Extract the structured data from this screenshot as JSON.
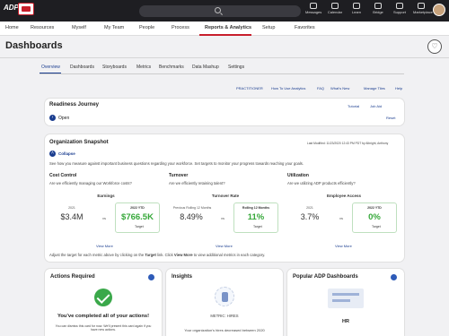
{
  "topbar": {
    "logo": "ADP",
    "icons": [
      {
        "label": "Messages",
        "icon": "envelope-icon"
      },
      {
        "label": "Calendar",
        "icon": "calendar-icon"
      },
      {
        "label": "Learn",
        "icon": "book-icon"
      },
      {
        "label": "Bridge",
        "icon": "bridge-icon"
      },
      {
        "label": "Support",
        "icon": "question-icon"
      },
      {
        "label": "Marketplace",
        "icon": "store-icon"
      }
    ]
  },
  "nav": {
    "items": [
      "Home",
      "Resources",
      "Myself",
      "My Team",
      "People",
      "Process",
      "Reports & Analytics",
      "Setup",
      "Favorites"
    ],
    "active": "Reports & Analytics"
  },
  "page": {
    "title": "Dashboards"
  },
  "tabs": {
    "items": [
      "Overview",
      "Dashboards",
      "Storyboards",
      "Metrics",
      "Benchmarks",
      "Data Mashup",
      "Settings"
    ],
    "active": "Overview"
  },
  "links": {
    "practitioner": "PRACTITIONER",
    "howto": "How To Use Analytics",
    "faq": "FAQ",
    "whatsnew": "What's New",
    "managetiles": "Manage Tiles",
    "help": "Help"
  },
  "readiness": {
    "title": "Readiness Journey",
    "status": "Open",
    "tutorial": "Tutorial",
    "jobaid": "Job Aid",
    "reset": "Reset"
  },
  "snapshot": {
    "title": "Organization Snapshot",
    "modified": "Last Modified: 11/23/2020 12:43 PM PDT by Albright, Anthony",
    "collapse": "Collapse",
    "intro": "See how you measure against important business questions regarding your workforce. Set targets to monitor your progress towards reaching your goals.",
    "footer_pre": "Adjust the target for each metric above by clicking on the ",
    "footer_target": "Target",
    "footer_mid": " link. Click ",
    "footer_viewmore": "View More",
    "footer_post": " to view additional metrics in each category.",
    "sections": [
      {
        "heading": "Cost Control",
        "question": "Are we efficiently managing our Workforce costs?",
        "metric": "Earnings",
        "prev_label": "2021",
        "prev_value": "$3.4M",
        "curr_label": "2022 YTD",
        "curr_value": "$766.5K",
        "target": "Target",
        "viewmore": "View More"
      },
      {
        "heading": "Turnover",
        "question": "Are we efficiently retaining talent?",
        "metric": "Turnover Rate",
        "prev_label": "Previous Rolling 12 Months",
        "prev_value": "8.49%",
        "curr_label": "Rolling 12 Months",
        "curr_value": "11%",
        "target": "Target",
        "viewmore": "View More"
      },
      {
        "heading": "Utilization",
        "question": "Are we utilizing ADP products efficiently?",
        "metric": "Employee Access",
        "prev_label": "2021",
        "prev_value": "3.7%",
        "curr_label": "2022 YTD",
        "curr_value": "0%",
        "target": "Target",
        "viewmore": "View More"
      }
    ],
    "vs": "vs"
  },
  "actions": {
    "title": "Actions Required",
    "done": "You've completed all of your actions!",
    "note": "You can dismiss this card for now. We'll present this card again if you have new actions."
  },
  "insights": {
    "title": "Insights",
    "metric": "METRIC: HIRES",
    "text": "Your organization's hires decreased between 2020"
  },
  "popular": {
    "title": "Popular ADP Dashboards",
    "item": "HR"
  }
}
